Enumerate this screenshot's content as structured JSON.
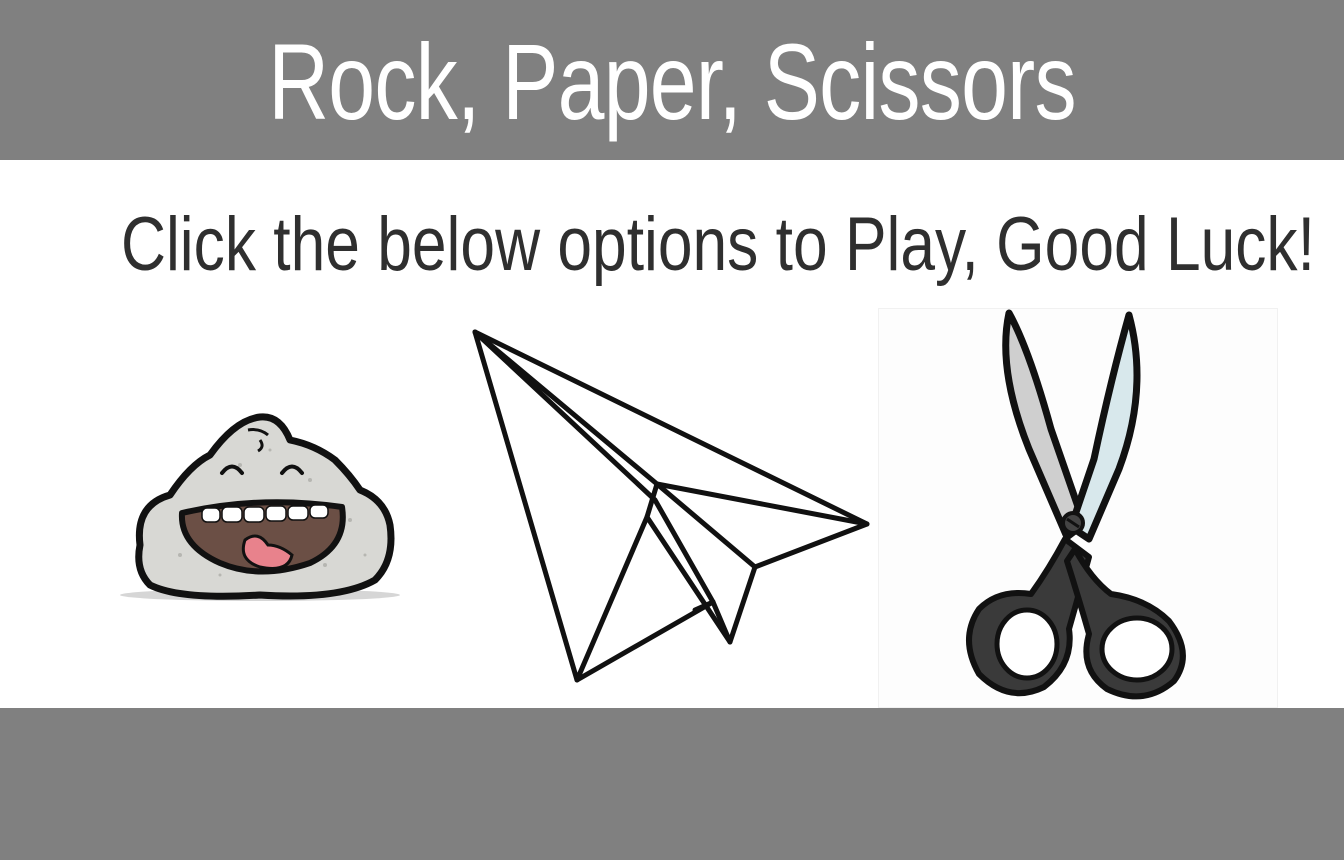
{
  "header": {
    "title": "Rock, Paper, Scissors",
    "background_color": "#808080",
    "text_color": "#ffffff"
  },
  "instructions": {
    "text": "Click the below options to Play, Good Luck!"
  },
  "choices": [
    {
      "id": "rock",
      "icon": "rock-cartoon-icon"
    },
    {
      "id": "paper",
      "icon": "paper-plane-icon"
    },
    {
      "id": "scissors",
      "icon": "scissors-icon"
    }
  ],
  "footer": {
    "background_color": "#808080"
  }
}
